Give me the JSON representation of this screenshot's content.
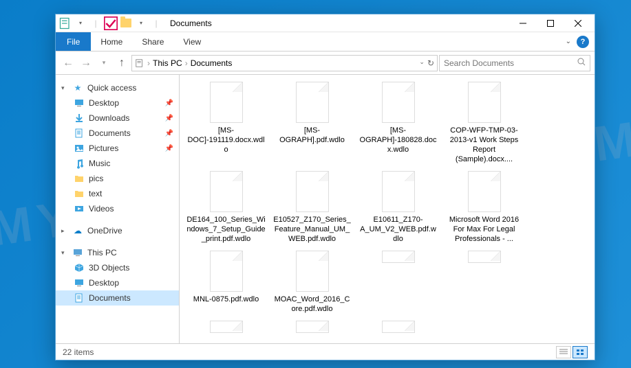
{
  "title": "Documents",
  "ribbon": {
    "file": "File",
    "tabs": [
      "Home",
      "Share",
      "View"
    ]
  },
  "breadcrumb": {
    "root": "This PC",
    "folder": "Documents"
  },
  "search": {
    "placeholder": "Search Documents"
  },
  "sidebar": {
    "quick": {
      "label": "Quick access",
      "items": [
        {
          "label": "Desktop",
          "icon": "desktop",
          "pinned": true
        },
        {
          "label": "Downloads",
          "icon": "downloads",
          "pinned": true
        },
        {
          "label": "Documents",
          "icon": "documents",
          "pinned": true
        },
        {
          "label": "Pictures",
          "icon": "pictures",
          "pinned": true
        },
        {
          "label": "Music",
          "icon": "music",
          "pinned": false
        },
        {
          "label": "pics",
          "icon": "folder",
          "pinned": false
        },
        {
          "label": "text",
          "icon": "folder",
          "pinned": false
        },
        {
          "label": "Videos",
          "icon": "videos",
          "pinned": false
        }
      ]
    },
    "onedrive": {
      "label": "OneDrive"
    },
    "thispc": {
      "label": "This PC",
      "items": [
        {
          "label": "3D Objects",
          "icon": "3d"
        },
        {
          "label": "Desktop",
          "icon": "desktop"
        },
        {
          "label": "Documents",
          "icon": "documents",
          "selected": true
        }
      ]
    }
  },
  "files": [
    {
      "name": "[MS-DOC]-191119.docx.wdlo"
    },
    {
      "name": "[MS-OGRAPH].pdf.wdlo"
    },
    {
      "name": "[MS-OGRAPH]-180828.docx.wdlo"
    },
    {
      "name": "COP-WFP-TMP-03-2013-v1 Work Steps Report (Sample).docx...."
    },
    {
      "name": "DE164_100_Series_Windows_7_Setup_Guide_print.pdf.wdlo"
    },
    {
      "name": "E10527_Z170_Series_Feature_Manual_UM_WEB.pdf.wdlo"
    },
    {
      "name": "E10611_Z170-A_UM_V2_WEB.pdf.wdlo"
    },
    {
      "name": "Microsoft Word 2016 For Max For Legal Professionals - ..."
    },
    {
      "name": "MNL-0875.pdf.wdlo"
    },
    {
      "name": "MOAC_Word_2016_Core.pdf.wdlo"
    }
  ],
  "partial_count": 5,
  "status": {
    "count": "22 items"
  },
  "watermark": "MYANTISPYWARE.COM"
}
